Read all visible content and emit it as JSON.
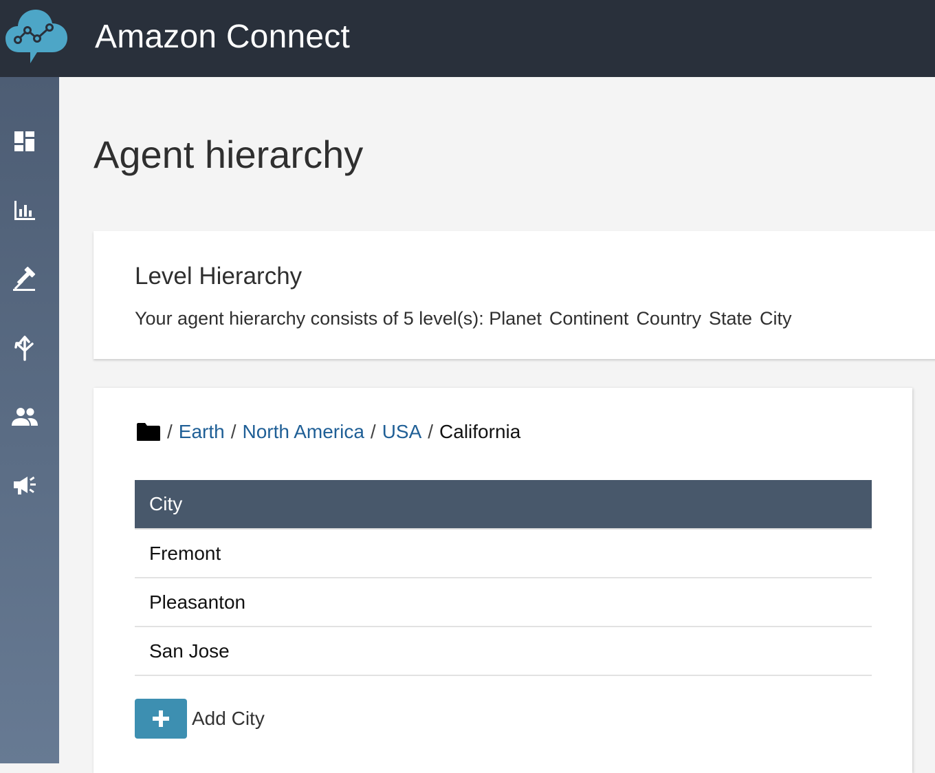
{
  "header": {
    "logo_icon": "amazon-connect-cloud-logo",
    "title": "Amazon Connect"
  },
  "sidebar": {
    "items": [
      {
        "icon": "dashboard-icon"
      },
      {
        "icon": "metrics-chart-icon"
      },
      {
        "icon": "routing-gavel-icon"
      },
      {
        "icon": "flows-arrows-icon"
      },
      {
        "icon": "users-icon"
      },
      {
        "icon": "campaigns-megaphone-icon"
      }
    ]
  },
  "page": {
    "title": "Agent hierarchy"
  },
  "level_hierarchy": {
    "title": "Level Hierarchy",
    "description_prefix": "Your agent hierarchy consists of 5 level(s):",
    "levels": [
      "Planet",
      "Continent",
      "Country",
      "State",
      "City"
    ]
  },
  "browser": {
    "root_icon": "folder-icon",
    "separator": "/",
    "breadcrumbs": [
      "Earth",
      "North America",
      "USA"
    ],
    "current": "California",
    "table": {
      "header": "City",
      "rows": [
        "Fremont",
        "Pleasanton",
        "San Jose"
      ]
    },
    "add_button_icon": "plus-icon",
    "add_label": "Add City"
  },
  "colors": {
    "topbar": "#29303b",
    "sidebar": "#5b6d85",
    "table_header": "#48586b",
    "link": "#1f5f96",
    "accent": "#3d8fb1"
  }
}
